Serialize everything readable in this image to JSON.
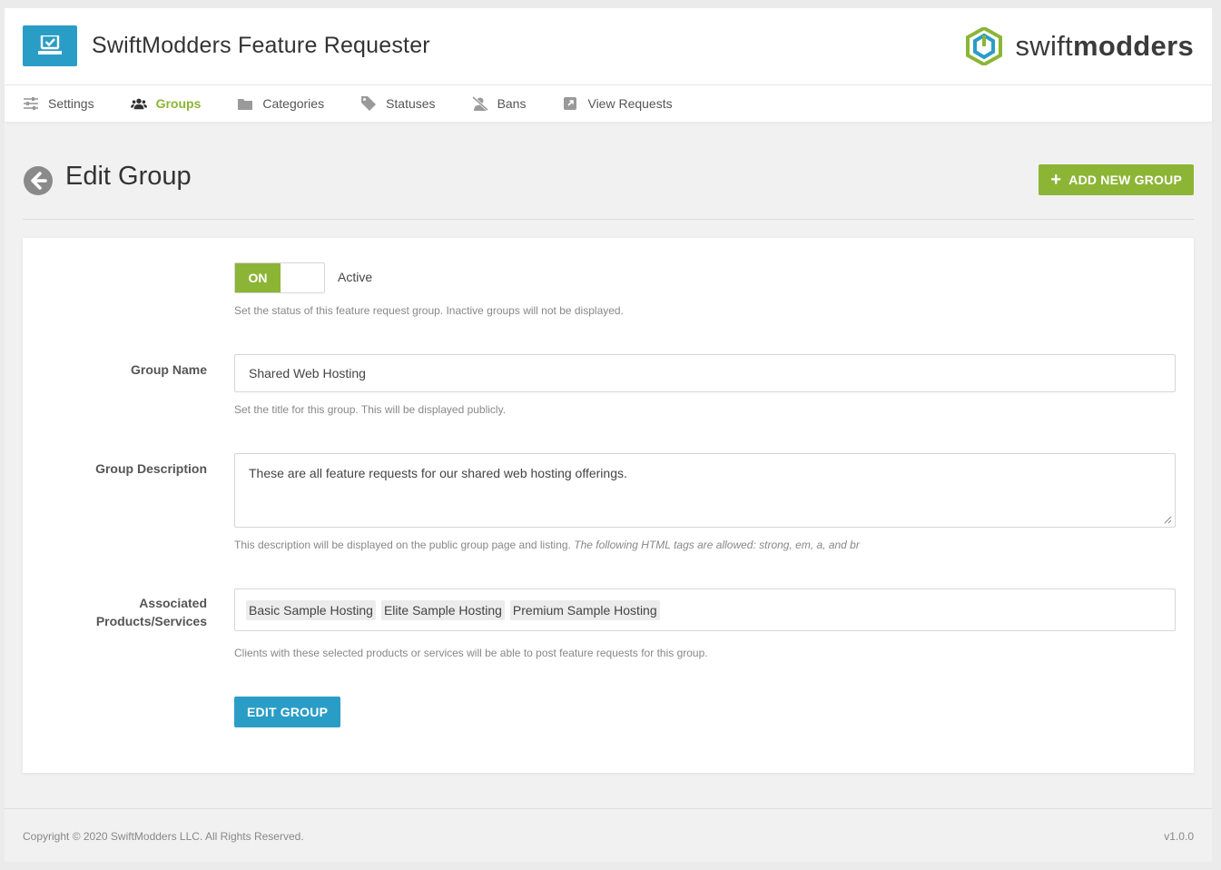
{
  "app": {
    "title": "SwiftModders Feature Requester",
    "brand_light": "swift",
    "brand_bold": "modders"
  },
  "nav": {
    "items": [
      {
        "label": "Settings",
        "icon": "sliders-icon"
      },
      {
        "label": "Groups",
        "icon": "users-icon",
        "active": true
      },
      {
        "label": "Categories",
        "icon": "folder-icon"
      },
      {
        "label": "Statuses",
        "icon": "tag-icon"
      },
      {
        "label": "Bans",
        "icon": "user-slash-icon"
      },
      {
        "label": "View Requests",
        "icon": "external-link-icon"
      }
    ]
  },
  "page": {
    "title": "Edit Group",
    "add_button_label": "ADD NEW GROUP"
  },
  "form": {
    "status": {
      "toggle_label": "ON",
      "value_label": "Active",
      "help": "Set the status of this feature request group. Inactive groups will not be displayed."
    },
    "group_name": {
      "label": "Group Name",
      "value": "Shared Web Hosting",
      "help": "Set the title for this group. This will be displayed publicly."
    },
    "group_description": {
      "label": "Group Description",
      "value": "These are all feature requests for our shared web hosting offerings.",
      "help": "This description will be displayed on the public group page and listing.",
      "help_em": "The following HTML tags are allowed: strong, em, a, and br"
    },
    "products": {
      "label_line1": "Associated",
      "label_line2": "Products/Services",
      "tags": [
        "Basic Sample Hosting",
        "Elite Sample Hosting",
        "Premium Sample Hosting"
      ],
      "help": "Clients with these selected products or services will be able to post feature requests for this group."
    },
    "submit_label": "EDIT GROUP"
  },
  "footer": {
    "copyright": "Copyright © 2020 SwiftModders LLC. All Rights Reserved.",
    "version": "v1.0.0"
  },
  "colors": {
    "accent_green": "#8cb536",
    "accent_blue": "#2a9dc6"
  }
}
